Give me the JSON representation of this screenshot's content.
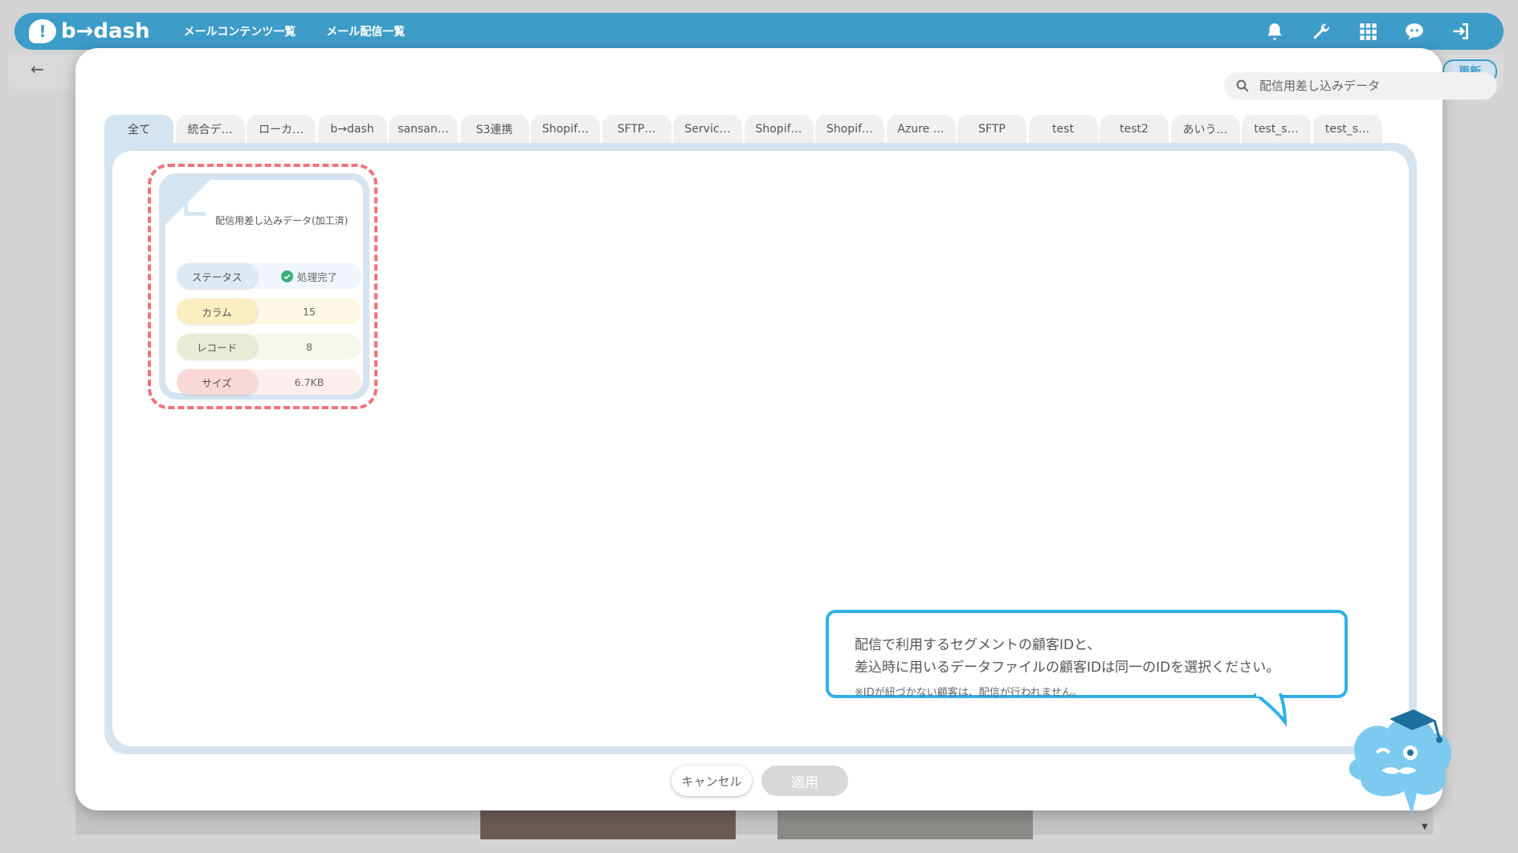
{
  "header": {
    "logo_text": "b→dash",
    "logo_mark": "!",
    "nav": [
      "メールコンテンツ一覧",
      "メール配信一覧"
    ],
    "icons": [
      "bell-icon",
      "wrench-icon",
      "grid-icon",
      "chat-icon",
      "logout-icon"
    ],
    "color": "#3e9cc8"
  },
  "subbar": {
    "back_label": "←",
    "refresh_label": "更新"
  },
  "search": {
    "placeholder": "配信用差し込みデータ"
  },
  "tabs": [
    "全て",
    "統合デ…",
    "ローカ…",
    "b→dash",
    "sansan…",
    "S3連携",
    "Shopif…",
    "SFTP…",
    "Servic…",
    "Shopif…",
    "Shopif…",
    "Azure …",
    "SFTP",
    "test",
    "test2",
    "あいう…",
    "test_s…",
    "test_s…"
  ],
  "active_tab": 0,
  "card": {
    "title": "配信用差し込みデータ(加工済)",
    "stats": [
      {
        "key": "ステータス",
        "value": "処理完了"
      },
      {
        "key": "カラム",
        "value": "15"
      },
      {
        "key": "レコード",
        "value": "8"
      },
      {
        "key": "サイズ",
        "value": "6.7KB"
      }
    ],
    "highlight_color": "#f2727b"
  },
  "bubble": {
    "line1": "配信で利用するセグメントの顧客IDと、",
    "line2": "差込時に用いるデータファイルの顧客IDは同一のIDを選択ください。",
    "note": "※IDが紐づかない顧客は、配信が行われません。",
    "border_color": "#2fb1e8"
  },
  "footer": {
    "cancel_label": "キャンセル",
    "apply_label": "適用"
  }
}
